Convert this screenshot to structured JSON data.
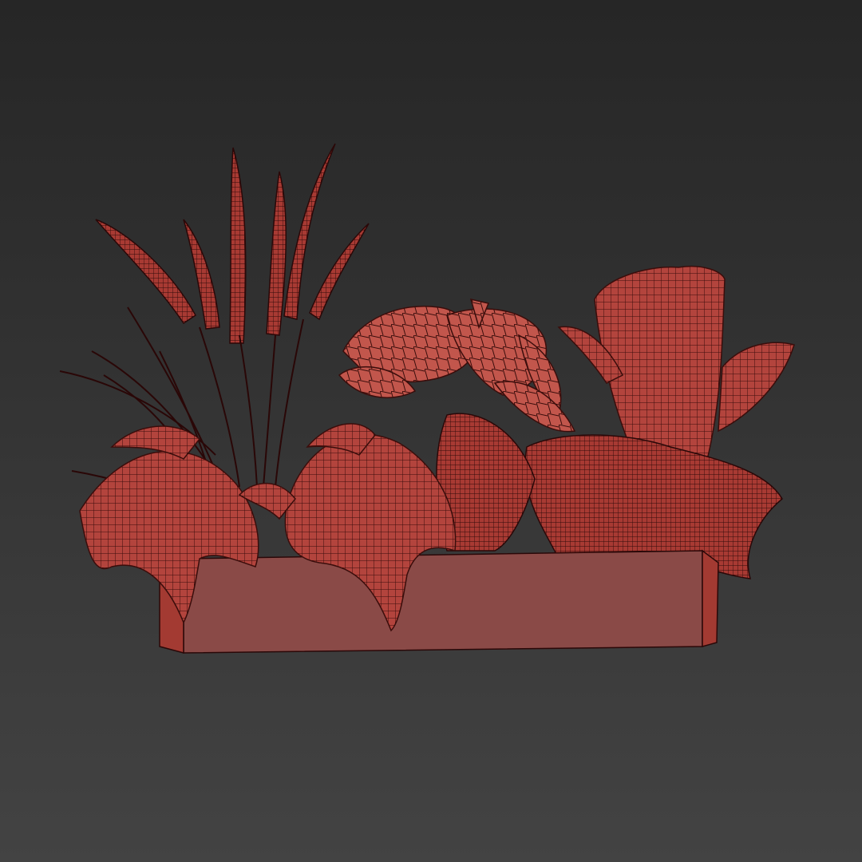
{
  "viewport": {
    "background_top": "#262626",
    "background_bottom": "#434343"
  },
  "scene": {
    "subject": "planter-with-plants",
    "render_mode": "wireframe",
    "mesh_color": "#b3443d",
    "mesh_highlight": "#c9685e",
    "wire_color": "#3a0d0b",
    "planter_front": "#8a4a47",
    "planter_side": "#a33a32"
  }
}
